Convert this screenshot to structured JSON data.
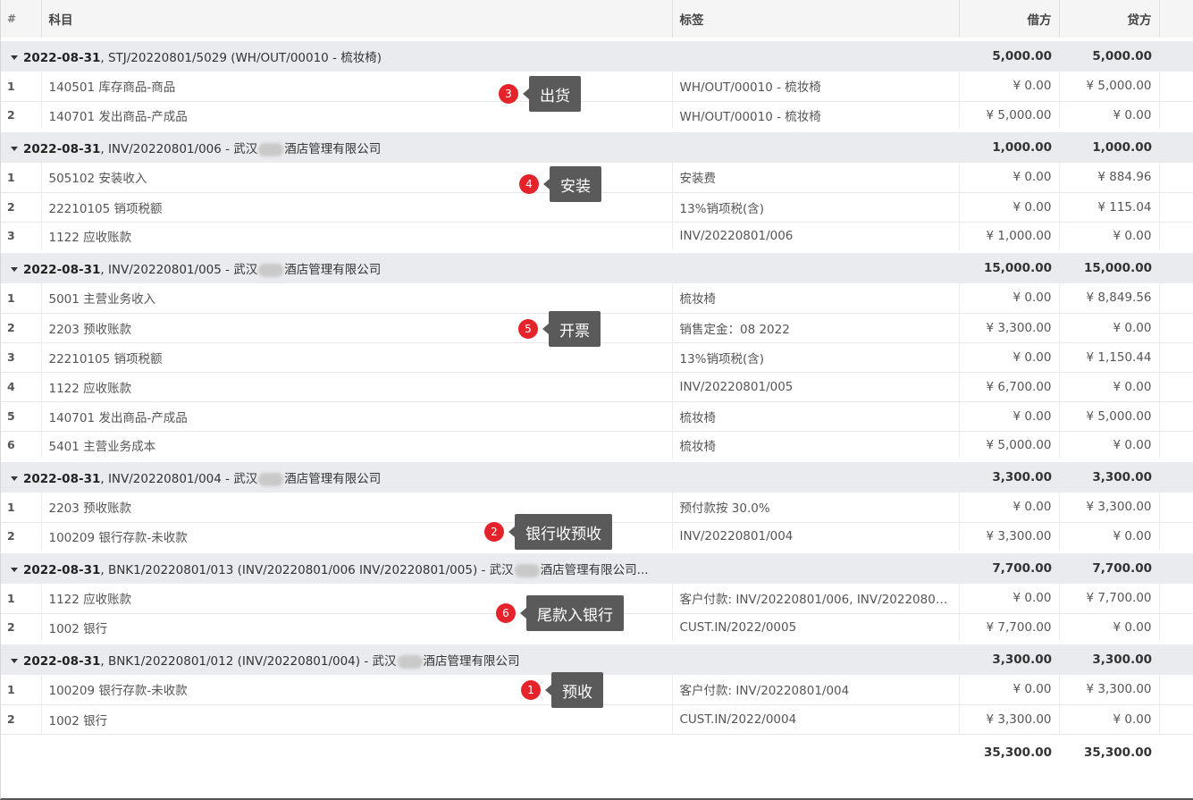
{
  "header": {
    "num": "#",
    "account": "科目",
    "label": "标签",
    "debit": "借方",
    "credit": "贷方"
  },
  "groups": [
    {
      "date": "2022-08-31",
      "rest": ", STJ/20220801/5029    (WH/OUT/00010 - 梳妆椅)",
      "rest_b": "",
      "debit": "5,000.00",
      "credit": "5,000.00",
      "lines": [
        {
          "n": "1",
          "account": "140501 库存商品-商品",
          "label": "WH/OUT/00010 - 梳妆椅",
          "debit": "¥ 0.00",
          "credit": "¥ 5,000.00"
        },
        {
          "n": "2",
          "account": "140701 发出商品-产成品",
          "label": "WH/OUT/00010 - 梳妆椅",
          "debit": "¥ 5,000.00",
          "credit": "¥ 0.00"
        }
      ]
    },
    {
      "date": "2022-08-31",
      "rest": ", INV/20220801/006 - 武汉",
      "rest_b": "酒店管理有限公司",
      "debit": "1,000.00",
      "credit": "1,000.00",
      "lines": [
        {
          "n": "1",
          "account": "505102 安装收入",
          "label": "安装费",
          "debit": "¥ 0.00",
          "credit": "¥ 884.96"
        },
        {
          "n": "2",
          "account": "22210105 销项税额",
          "label": "13%销项税(含)",
          "debit": "¥ 0.00",
          "credit": "¥ 115.04"
        },
        {
          "n": "3",
          "account": "1122 应收账款",
          "label": "INV/20220801/006",
          "debit": "¥ 1,000.00",
          "credit": "¥ 0.00"
        }
      ]
    },
    {
      "date": "2022-08-31",
      "rest": ", INV/20220801/005 - 武汉",
      "rest_b": "酒店管理有限公司",
      "debit": "15,000.00",
      "credit": "15,000.00",
      "lines": [
        {
          "n": "1",
          "account": "5001 主营业务收入",
          "label": "梳妆椅",
          "debit": "¥ 0.00",
          "credit": "¥ 8,849.56"
        },
        {
          "n": "2",
          "account": "2203 预收账款",
          "label": "销售定金：08 2022",
          "debit": "¥ 3,300.00",
          "credit": "¥ 0.00"
        },
        {
          "n": "3",
          "account": "22210105 销项税额",
          "label": "13%销项税(含)",
          "debit": "¥ 0.00",
          "credit": "¥ 1,150.44"
        },
        {
          "n": "4",
          "account": "1122 应收账款",
          "label": "INV/20220801/005",
          "debit": "¥ 6,700.00",
          "credit": "¥ 0.00"
        },
        {
          "n": "5",
          "account": "140701 发出商品-产成品",
          "label": "梳妆椅",
          "debit": "¥ 0.00",
          "credit": "¥ 5,000.00"
        },
        {
          "n": "6",
          "account": "5401 主营业务成本",
          "label": "梳妆椅",
          "debit": "¥ 5,000.00",
          "credit": "¥ 0.00"
        }
      ]
    },
    {
      "date": "2022-08-31",
      "rest": ", INV/20220801/004 - 武汉",
      "rest_b": "酒店管理有限公司",
      "debit": "3,300.00",
      "credit": "3,300.00",
      "lines": [
        {
          "n": "1",
          "account": "2203 预收账款",
          "label": "预付款按 30.0%",
          "debit": "¥ 0.00",
          "credit": "¥ 3,300.00"
        },
        {
          "n": "2",
          "account": "100209 银行存款-未收款",
          "label": "INV/20220801/004",
          "debit": "¥ 3,300.00",
          "credit": "¥ 0.00"
        }
      ]
    },
    {
      "date": "2022-08-31",
      "rest": ", BNK1/20220801/013    (INV/20220801/006 INV/20220801/005) - 武汉",
      "rest_b": "酒店管理有限公司...",
      "debit": "7,700.00",
      "credit": "7,700.00",
      "lines": [
        {
          "n": "1",
          "account": "1122 应收账款",
          "label": "客户付款: INV/20220801/006, INV/20220801/0...",
          "debit": "¥ 0.00",
          "credit": "¥ 7,700.00"
        },
        {
          "n": "2",
          "account": "1002 银行",
          "label": "CUST.IN/2022/0005",
          "debit": "¥ 7,700.00",
          "credit": "¥ 0.00"
        }
      ]
    },
    {
      "date": "2022-08-31",
      "rest": ", BNK1/20220801/012    (INV/20220801/004) - 武汉",
      "rest_b": "酒店管理有限公司",
      "debit": "3,300.00",
      "credit": "3,300.00",
      "lines": [
        {
          "n": "1",
          "account": "100209 银行存款-未收款",
          "label": "客户付款: INV/20220801/004",
          "debit": "¥ 0.00",
          "credit": "¥ 3,300.00"
        },
        {
          "n": "2",
          "account": "1002 银行",
          "label": "CUST.IN/2022/0004",
          "debit": "¥ 3,300.00",
          "credit": "¥ 0.00"
        }
      ]
    }
  ],
  "totals": {
    "debit": "35,300.00",
    "credit": "35,300.00"
  },
  "callouts": [
    {
      "n": "3",
      "text": "出货"
    },
    {
      "n": "4",
      "text": "安装"
    },
    {
      "n": "5",
      "text": "开票"
    },
    {
      "n": "2",
      "text": "银行收预收"
    },
    {
      "n": "6",
      "text": "尾款入银行"
    },
    {
      "n": "1",
      "text": "预收"
    }
  ],
  "colors": {
    "badge": "#e5232b",
    "bubble": "#5a5a5a",
    "group_bg": "#e9ebee",
    "header_bg": "#f5f5f5"
  }
}
